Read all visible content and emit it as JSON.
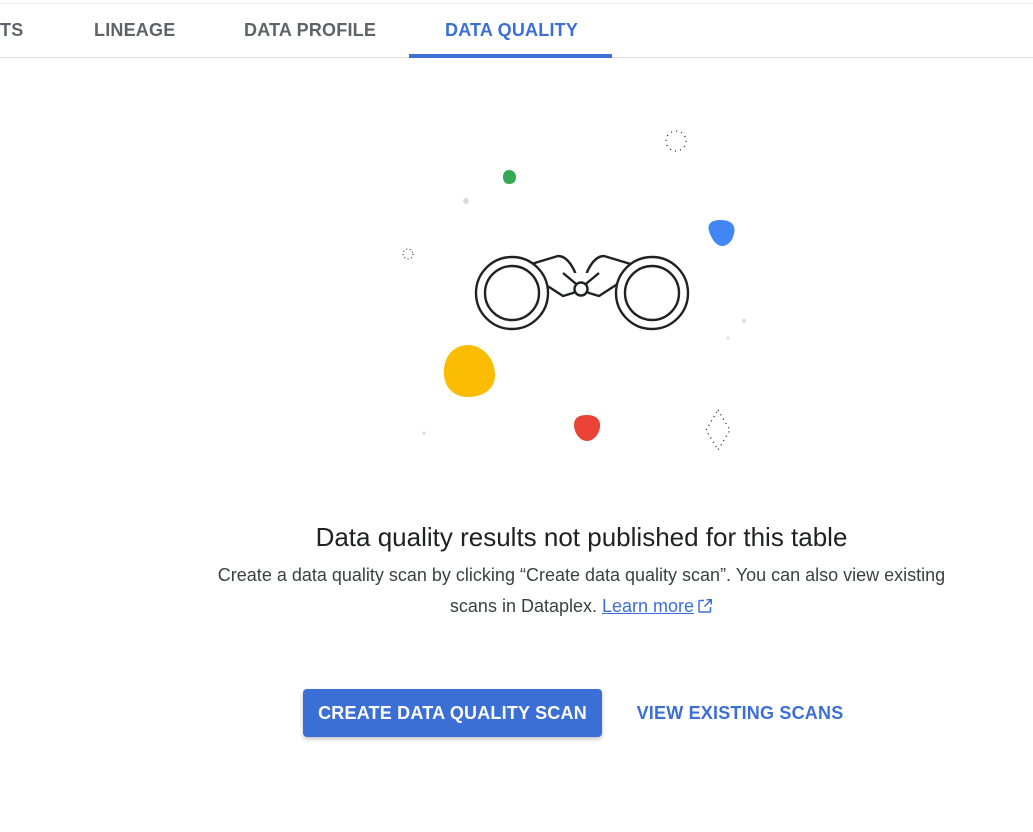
{
  "tabs": [
    {
      "label": "TS",
      "active": false
    },
    {
      "label": "LINEAGE",
      "active": false
    },
    {
      "label": "DATA PROFILE",
      "active": false
    },
    {
      "label": "DATA QUALITY",
      "active": true
    }
  ],
  "empty_state": {
    "illustration_icon": "binoculars-icon",
    "title": "Data quality results not published for this table",
    "description_part1": "Create a data quality scan by clicking “Create data quality scan”. You can also view existing scans in Dataplex. ",
    "learn_more_label": "Learn more",
    "external_link_icon": "open-in-new-icon"
  },
  "actions": {
    "create_label": "CREATE DATA QUALITY SCAN",
    "view_label": "VIEW EXISTING SCANS"
  },
  "colors": {
    "accent": "#3c6fd6",
    "blob_yellow": "#fbbc04",
    "blob_red": "#ea4335",
    "blob_blue": "#4285f4",
    "blob_green": "#34a853"
  }
}
